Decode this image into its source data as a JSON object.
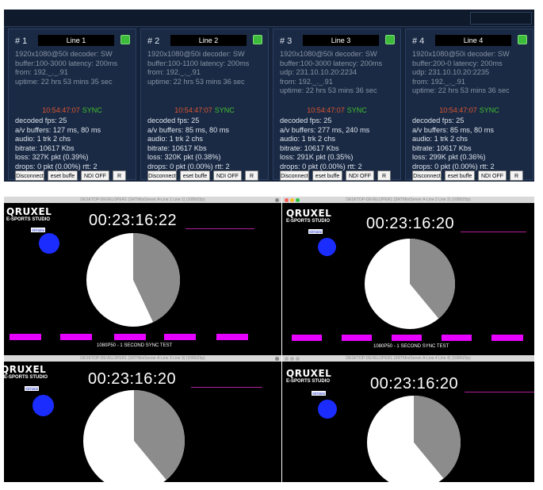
{
  "lines": [
    {
      "number": "# 1",
      "name": "Line 1",
      "info": [
        "1920x1080@50i decoder: SW",
        "buffer:100-3000 latency: 200ms",
        "from: 192._._.91",
        "uptime: 22 hrs 53 mins 35 sec"
      ],
      "clock_time": "10:54:47:07",
      "sync": "SYNC",
      "stats": [
        "decoded fps: 25",
        "a/v buffers: 127 ms, 80 ms",
        "audio: 1 trk 2 chs",
        "bitrate: 10617 Kbs",
        "loss: 327K pkt (0.39%)",
        "drops: 0 pkt (0.00%) rtt: 2"
      ],
      "buttons": {
        "disconnect": "Disconnect",
        "reset": "eset buffe",
        "ndi": "NDI OFF",
        "r": "R"
      }
    },
    {
      "number": "# 2",
      "name": "Line 2",
      "info": [
        "1920x1080@50i decoder: SW",
        "buffer:100-1100 latency: 200ms",
        "from: 192._._.91",
        "uptime: 22 hrs 53 mins 36 sec"
      ],
      "clock_time": "10:54:47:07",
      "sync": "SYNC",
      "stats": [
        "decoded fps: 25",
        "a/v buffers: 85 ms, 80 ms",
        "audio: 1 trk 2 chs",
        "bitrate: 10617 Kbs",
        "loss: 320K pkt (0.38%)",
        "drops: 0 pkt (0.00%) rtt: 2"
      ],
      "buttons": {
        "disconnect": "Disconnect",
        "reset": "eset buffe",
        "ndi": "NDI OFF",
        "r": "R"
      }
    },
    {
      "number": "# 3",
      "name": "Line 3",
      "info": [
        "1920x1080@50i decoder: SW",
        "buffer:100-3000 latency: 200ms",
        "udp: 231.10.10.20:2234",
        "from: 192._._.91",
        "uptime: 22 hrs 53 mins 36 sec"
      ],
      "clock_time": "10:54:47:07",
      "sync": "SYNC",
      "stats": [
        "decoded fps: 25",
        "a/v buffers: 277 ms, 240 ms",
        "audio: 1 trk 2 chs",
        "bitrate: 10617 Kbs",
        "loss: 291K pkt (0.35%)",
        "drops: 0 pkt (0.00%) rtt: 2"
      ],
      "buttons": {
        "disconnect": "Disconnect",
        "reset": "eset buffe",
        "ndi": "NDI OFF",
        "r": "R"
      }
    },
    {
      "number": "# 4",
      "name": "Line 4",
      "info": [
        "1920x1080@50i decoder: SW",
        "buffer:200-0 latency: 200ms",
        "udp: 231.10.10.20:2235",
        "from: 192._._.91",
        "uptime: 22 hrs 53 mins 36 sec"
      ],
      "clock_time": "10:54:47:07",
      "sync": "SYNC",
      "stats": [
        "decoded fps: 25",
        "a/v buffers: 85 ms, 80 ms",
        "audio: 1 trk 2 chs",
        "bitrate: 10617 Kbs",
        "loss: 299K pkt (0.36%)",
        "drops: 0 pkt (0.00%) rtt: 2"
      ],
      "buttons": {
        "disconnect": "Disconnect",
        "reset": "eset buffe",
        "ndi": "NDI OFF",
        "r": "R"
      }
    }
  ],
  "monitors": [
    {
      "title": "DESKTOP-DEVELOPER1 (SRTMiniServer A-Line 1 Line 1) (1080i25p)",
      "logo": "QRUXEL",
      "studio": "E-SPORTS STUDIO",
      "tag": "SRTMINI",
      "timecode": "00:23:16:22",
      "caption": "1080P50 - 1 SECOND SYNC TEST",
      "pie_fraction": 0.43
    },
    {
      "title": "DESKTOP-DEVELOPER1 (SRTMiniServer A-Line 2 Line 2) (1080i25p)",
      "logo": "QRUXEL",
      "studio": "E-SPORTS STUDIO",
      "tag": "SRTMINI",
      "timecode": "00:23:16:20",
      "caption": "1080P50 - 1 SECOND SYNC TEST",
      "pie_fraction": 0.39
    },
    {
      "title": "DESKTOP-DEVELOPER1 (SRTMiniServer A-Line 3 Line 3) (1080i25p)",
      "logo": "QRUXEL",
      "studio": "E-SPORTS STUDIO",
      "tag": "SRTMINI",
      "timecode": "00:23:16:20",
      "caption": "",
      "pie_fraction": 0.39
    },
    {
      "title": "DESKTOP-DEVELOPER1 (SRTMiniServer A-Line 4 Line 4) (1080i25p)",
      "logo": "QRUXEL",
      "studio": "E-SPORTS STUDIO",
      "tag": "SRTMINI",
      "timecode": "00:23:16:20",
      "caption": "",
      "pie_fraction": 0.39
    }
  ],
  "colors": {
    "panel_bg": "#15233a",
    "card_bg": "#1a2a44",
    "status_led": "#3dbb3a",
    "clock_time": "#e0552f",
    "sync_text": "#3fbf2f",
    "pie_gray": "#8c8c8c",
    "pie_white": "#ffffff",
    "magenta_bar": "#e600ff",
    "blue_dot": "#1b2cff"
  },
  "icons": [
    "status-led-icon",
    "window-close-icon",
    "window-minimize-icon",
    "window-maximize-icon"
  ]
}
